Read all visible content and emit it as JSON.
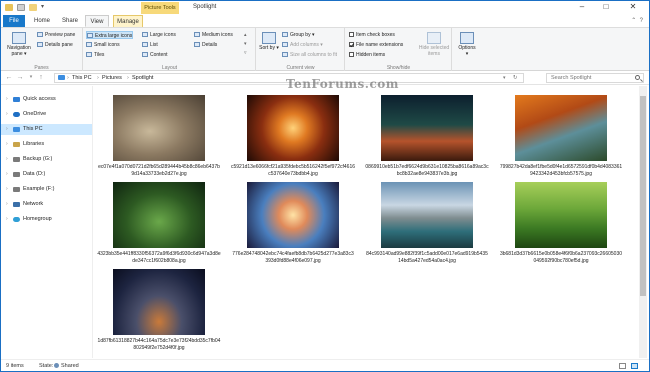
{
  "titlebar": {
    "context_tab": "Picture Tools",
    "title": "Spotlight"
  },
  "ribbon_tabs": [
    {
      "label": "File"
    },
    {
      "label": "Home"
    },
    {
      "label": "Share"
    },
    {
      "label": "View"
    },
    {
      "label": "Manage"
    }
  ],
  "ribbon": {
    "panes": {
      "label": "Panes",
      "navigation_pane": "Navigation pane ▾",
      "preview_pane": "Preview pane",
      "details_pane": "Details pane"
    },
    "layout": {
      "label": "Layout",
      "items": [
        "Extra large icons",
        "Large icons",
        "Medium icons",
        "Small icons",
        "List",
        "Details",
        "Tiles",
        "Content"
      ]
    },
    "current_view": {
      "label": "Current view",
      "sort_by": "Sort by ▾",
      "group_by": "Group by ▾",
      "add_columns": "Add columns ▾",
      "size_all": "Size all columns to fit"
    },
    "show_hide": {
      "label": "Show/hide",
      "item_check_boxes": "Item check boxes",
      "file_name_extensions": "File name extensions",
      "hidden_items": "Hidden items",
      "hide_selected": "Hide selected items"
    },
    "options": {
      "label": "Options"
    }
  },
  "address": {
    "crumbs": [
      "This PC",
      "Pictures",
      "Spotlight"
    ],
    "search_placeholder": "Search Spotlight"
  },
  "nav": {
    "items": [
      {
        "label": "Quick access",
        "color": "#2f7fd6"
      },
      {
        "label": "OneDrive",
        "color": "#1f6fc4"
      },
      {
        "label": "This PC",
        "color": "#3b8de0"
      },
      {
        "label": "Libraries",
        "color": "#c9a44a"
      },
      {
        "label": "Backup (G:)",
        "color": "#7a7a7a"
      },
      {
        "label": "Data (D:)",
        "color": "#7a7a7a"
      },
      {
        "label": "Example (F:)",
        "color": "#7a7a7a"
      },
      {
        "label": "Network",
        "color": "#3b6fa8"
      },
      {
        "label": "Homegroup",
        "color": "#2f9fd6"
      }
    ]
  },
  "files": [
    {
      "name": "ec07e4f1a070d0721d2fb65d289444b45b8c86eb6437b9d14a33733eb2d27e.jpg",
      "bg": "radial-gradient(ellipse at 40% 55%, #c8b89a 0%, #8c7a62 45%, #4a3f33 100%)"
    },
    {
      "name": "c5921d13e6066fcf21a935fdebc5b516242f5ef972cf4616c537640e73bdbb4.jpg",
      "bg": "radial-gradient(circle at 50% 50%, #ffd27a 0%, #e07a22 25%, #8a2e10 55%, #1e0a05 100%)"
    },
    {
      "name": "0869910eb51b7edf6624d9b631e10825ba8616a89ac3cbc8b32ae8e943837e3b.jpg",
      "bg": "linear-gradient(180deg, #0c1f2e 0%, #1f4a46 45%, #b5532c 70%, #3a1a0d 100%)"
    },
    {
      "name": "799827b42da8ef1fbe5d0f4e1d6572591df0b4d40833619423342d453bfcb57575.jpg",
      "bg": "linear-gradient(160deg, #e37a1d 0%, #b24a16 35%, #5d8f9a 60%, #2c4a2a 100%)"
    },
    {
      "name": "4323bb35e441ff8330f56372a9f6d3f6d930c6d947a3d8ede347cc1f602b808a.jpg",
      "bg": "radial-gradient(ellipse at 50% 60%, #6aa84a 0%, #2d5a22 50%, #0f2410 100%)"
    },
    {
      "name": "776e284748042ebc74c4faefb8db7b6425d277e3a83c3393d0fd88e4f06e097.jpg",
      "bg": "radial-gradient(circle at 50% 50%, #ffe3a6 0%, #e08a5a 25%, #4a7fbf 55%, #1a1a3a 100%)"
    },
    {
      "name": "84c993140ad99e882f39f1c5add00e017e6ad919b543514bd5a427ed54a0ac4.jpg",
      "bg": "linear-gradient(180deg, #6b93b5 0%, #c9d7e3 35%, #7e8c8f 55%, #2e6e7a 75%, #1c3a40 100%)"
    },
    {
      "name": "3b681d3d37b6615e0b058e4f6f0b6a237093c26605030049592f90bc780ef5d.jpg",
      "bg": "linear-gradient(180deg, #a7cf5a 0%, #6da83a 40%, #3c7a23 70%, #1e4612 100%)"
    },
    {
      "name": "1d87fb61318827b44c164a75dc7e3e73f24bdd35c7fb04802949f2e752d4f0f.jpg",
      "bg": "radial-gradient(ellipse at 50% 80%, #c97a3a 0%, #4a4f6a 35%, #1d2440 70%, #0a0d1e 100%)"
    }
  ],
  "watermark": "TenForums.com",
  "status": {
    "items_count": "9 items",
    "state_label": "State:",
    "state_value": "Shared"
  }
}
